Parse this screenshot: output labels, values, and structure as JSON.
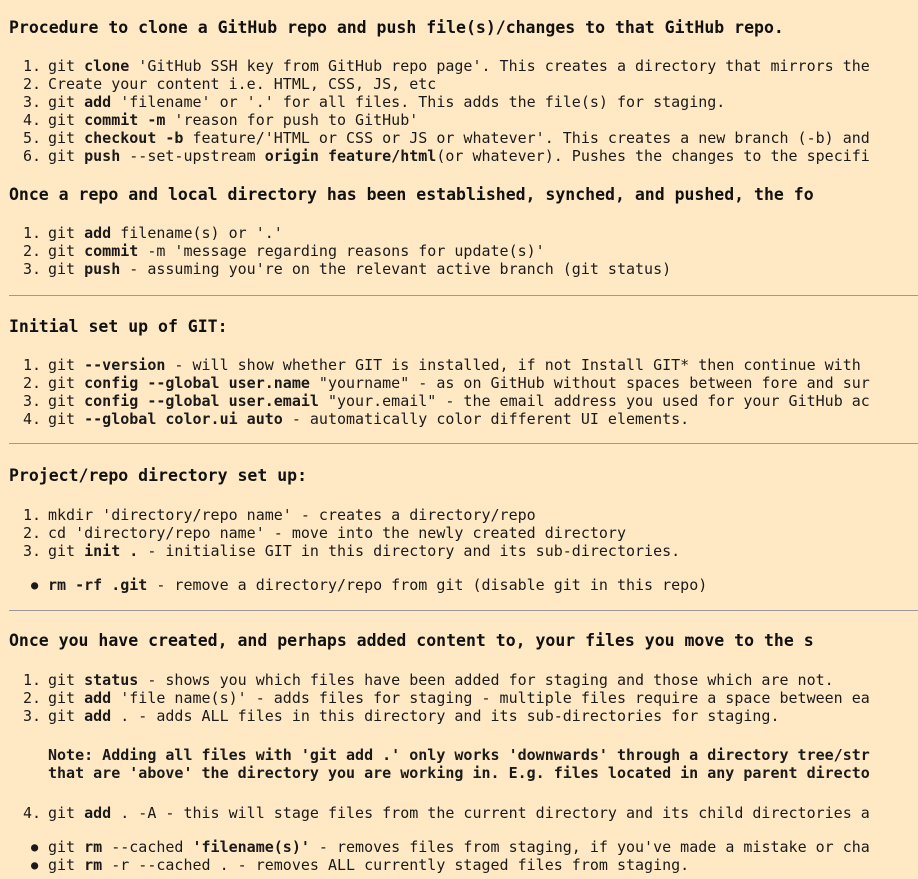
{
  "sections": {
    "clone": {
      "title": "Procedure to clone a GitHub repo and push file(s)/changes to that GitHub repo.",
      "items": [
        {
          "n": "1.",
          "pre": "git ",
          "cmd": "clone",
          "post": " 'GitHub SSH key from GitHub repo page'. This creates a directory that mirrors the"
        },
        {
          "n": "2.",
          "pre": "Create your content i.e. HTML, CSS, JS, etc",
          "cmd": "",
          "post": ""
        },
        {
          "n": "3.",
          "pre": "git ",
          "cmd": "add",
          "post": " 'filename' or '.' for all files. This adds the file(s) for staging."
        },
        {
          "n": "4.",
          "pre": "git ",
          "cmd": "commit -m",
          "post": " 'reason for push to GitHub'"
        },
        {
          "n": "5.",
          "pre": "git ",
          "cmd": "checkout -b",
          "post": " feature/'HTML or CSS or JS or whatever'. This creates a new branch (-b) and"
        },
        {
          "n": "6.",
          "pre": "git ",
          "cmd": "push",
          "post": " --set-upstream ",
          "cmd2": "origin feature/html",
          "post2": "(or whatever). Pushes the changes to the specifi"
        }
      ]
    },
    "established": {
      "title": "Once a repo and local directory has been established, synched, and pushed, the fo",
      "items": [
        {
          "n": "1.",
          "pre": "git ",
          "cmd": "add",
          "post": " filename(s) or '.'"
        },
        {
          "n": "2.",
          "pre": "git ",
          "cmd": "commit",
          "post": " -m 'message regarding reasons for update(s)'"
        },
        {
          "n": "3.",
          "pre": "git ",
          "cmd": "push",
          "post": " - assuming you're on the relevant active branch (git status)"
        }
      ]
    },
    "initial": {
      "title": "Initial set up of GIT:",
      "items": [
        {
          "n": "1.",
          "pre": "git ",
          "cmd": "--version",
          "post": " - will show whether GIT is installed, if not Install GIT* then continue with"
        },
        {
          "n": "2.",
          "pre": "git ",
          "cmd": "config --global user.name",
          "post": " \"yourname\" - as on GitHub without spaces between fore and sur"
        },
        {
          "n": "3.",
          "pre": "git ",
          "cmd": "config --global user.email",
          "post": " \"your.email\" - the email address you used for your GitHub ac"
        },
        {
          "n": "4.",
          "pre": "git ",
          "cmd": "--global color.ui auto",
          "post": " - automatically color different UI elements."
        }
      ]
    },
    "project": {
      "title": "Project/repo directory set up:",
      "items": [
        {
          "n": "1.",
          "pre": "mkdir 'directory/repo name' - creates a directory/repo",
          "cmd": "",
          "post": ""
        },
        {
          "n": "2.",
          "pre": "cd 'directory/repo name' - move into the newly created directory",
          "cmd": "",
          "post": ""
        },
        {
          "n": "3.",
          "pre": "git ",
          "cmd": "init .",
          "post": " - initialise GIT in this directory and its sub-directories."
        }
      ],
      "bullets": [
        {
          "pre": "",
          "cmd": "rm -rf .git",
          "post": " - remove a directory/repo from git (disable git in this repo)"
        }
      ]
    },
    "staging": {
      "title": "Once you have created, and perhaps added content to, your files you move to the s",
      "items": [
        {
          "n": "1.",
          "pre": "git ",
          "cmd": "status",
          "post": " - shows you which files have been added for staging and those which are not."
        },
        {
          "n": "2.",
          "pre": "git ",
          "cmd": "add",
          "post": " 'file name(s)' - adds files for staging - multiple files require a space between ea"
        },
        {
          "n": "3.",
          "pre": "git ",
          "cmd": "add",
          "post": " . - adds ALL files in this directory and its sub-directories for staging."
        }
      ],
      "note_line1": "Note: Adding all files with 'git add .' only works 'downwards' through a directory tree/str",
      "note_line2": "that are 'above' the directory you are working in. E.g. files located in any parent directo",
      "item4": {
        "n": "4.",
        "pre": "git ",
        "cmd": "add",
        "post": " . -A - this will stage files from the current directory and its child directories a"
      },
      "bullets": [
        {
          "pre": "git ",
          "cmd": "rm",
          "post": " --cached ",
          "cmd2": "'filename(s)'",
          "post2": " - removes files from staging, if you've made a mistake or cha"
        },
        {
          "pre": "git ",
          "cmd": "rm",
          "post": " -r --cached . - removes ALL currently staged files from staging."
        }
      ]
    }
  }
}
